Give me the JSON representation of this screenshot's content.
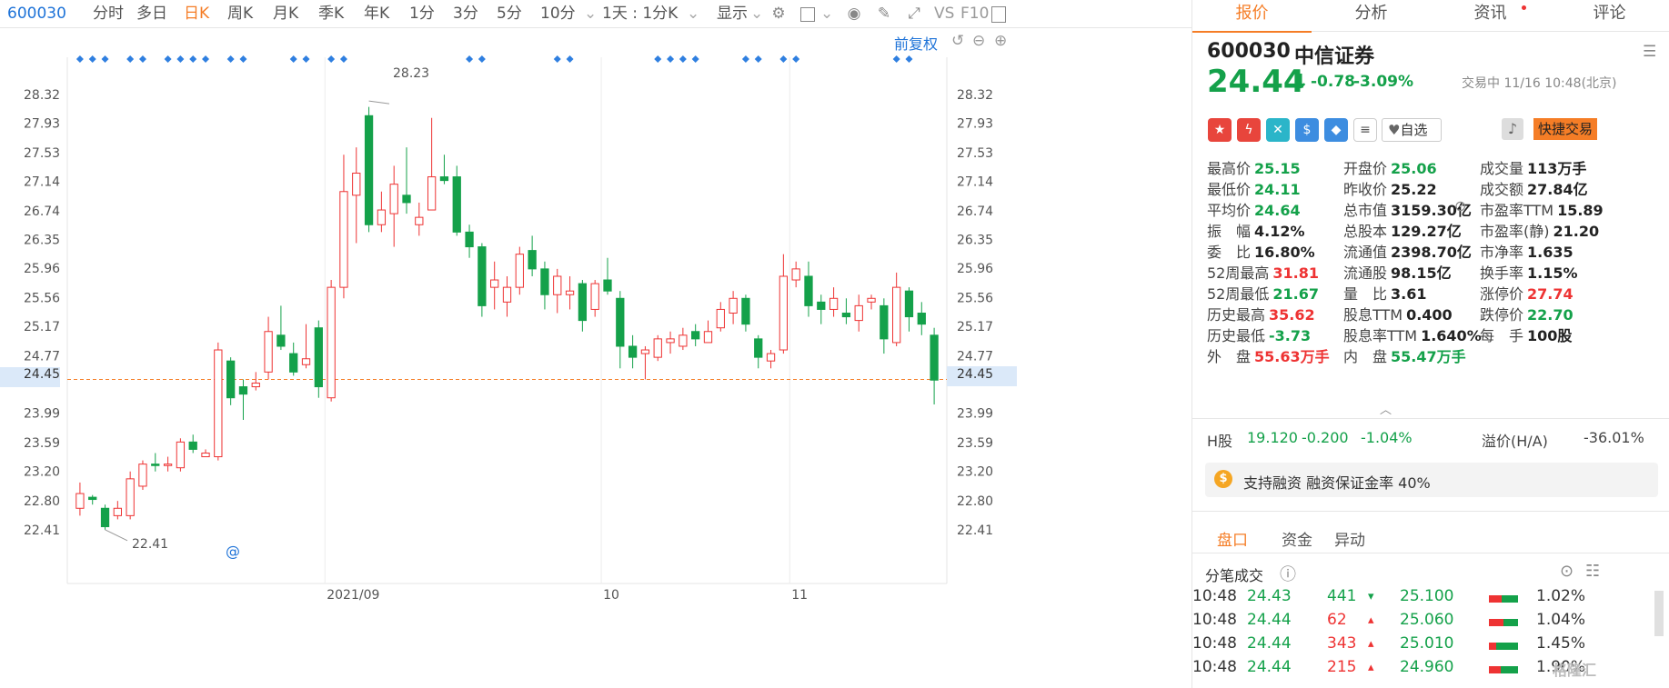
{
  "toolbar": {
    "code": "600030",
    "periods": [
      "分时",
      "多日",
      "日K",
      "周K",
      "月K",
      "季K",
      "年K",
      "1分",
      "3分",
      "5分",
      "10分"
    ],
    "active_period": "日K",
    "interval_select": "1天 : 1分K",
    "display_label": "显示",
    "vs_label": "VS",
    "f10_label": "F10"
  },
  "chart": {
    "restore_label": "前复权",
    "current_price_label": "24.45",
    "max_annotation": "28.23",
    "min_annotation": "22.41",
    "month_labels": [
      "2021/09",
      "10",
      "11"
    ]
  },
  "chart_data": {
    "type": "candlestick",
    "y_ticks": [
      28.32,
      27.93,
      27.53,
      27.14,
      26.74,
      26.35,
      25.96,
      25.56,
      25.17,
      24.77,
      24.45,
      23.99,
      23.59,
      23.2,
      22.8,
      22.41
    ],
    "ylim": [
      22.0,
      28.7
    ],
    "current_price": 24.45,
    "candles": [
      {
        "o": 22.7,
        "c": 22.9,
        "h": 23.05,
        "l": 22.6
      },
      {
        "o": 22.85,
        "c": 22.82,
        "h": 22.88,
        "l": 22.75
      },
      {
        "o": 22.7,
        "c": 22.45,
        "h": 22.75,
        "l": 22.41
      },
      {
        "o": 22.6,
        "c": 22.7,
        "h": 22.8,
        "l": 22.55
      },
      {
        "o": 22.6,
        "c": 23.1,
        "h": 23.2,
        "l": 22.55
      },
      {
        "o": 23.0,
        "c": 23.3,
        "h": 23.35,
        "l": 22.95
      },
      {
        "o": 23.3,
        "c": 23.28,
        "h": 23.45,
        "l": 23.2
      },
      {
        "o": 23.28,
        "c": 23.3,
        "h": 23.4,
        "l": 23.2
      },
      {
        "o": 23.25,
        "c": 23.6,
        "h": 23.65,
        "l": 23.2
      },
      {
        "o": 23.6,
        "c": 23.5,
        "h": 23.7,
        "l": 23.45
      },
      {
        "o": 23.4,
        "c": 23.45,
        "h": 23.5,
        "l": 23.4
      },
      {
        "o": 23.4,
        "c": 24.85,
        "h": 24.95,
        "l": 23.35
      },
      {
        "o": 24.7,
        "c": 24.2,
        "h": 24.75,
        "l": 24.1
      },
      {
        "o": 24.35,
        "c": 24.25,
        "h": 24.45,
        "l": 23.9
      },
      {
        "o": 24.35,
        "c": 24.4,
        "h": 24.55,
        "l": 24.3
      },
      {
        "o": 24.55,
        "c": 25.1,
        "h": 25.3,
        "l": 24.45
      },
      {
        "o": 25.05,
        "c": 24.9,
        "h": 25.45,
        "l": 24.85
      },
      {
        "o": 24.8,
        "c": 24.55,
        "h": 24.95,
        "l": 24.5
      },
      {
        "o": 24.65,
        "c": 24.73,
        "h": 25.2,
        "l": 24.6
      },
      {
        "o": 25.15,
        "c": 24.35,
        "h": 25.25,
        "l": 24.2
      },
      {
        "o": 24.2,
        "c": 25.7,
        "h": 25.8,
        "l": 24.15
      },
      {
        "o": 25.7,
        "c": 27.0,
        "h": 27.5,
        "l": 25.55
      },
      {
        "o": 26.95,
        "c": 27.25,
        "h": 27.6,
        "l": 26.3
      },
      {
        "o": 28.03,
        "c": 26.55,
        "h": 28.15,
        "l": 26.45
      },
      {
        "o": 26.55,
        "c": 26.75,
        "h": 27.0,
        "l": 26.45
      },
      {
        "o": 26.7,
        "c": 27.1,
        "h": 27.35,
        "l": 26.25
      },
      {
        "o": 26.95,
        "c": 26.85,
        "h": 27.6,
        "l": 26.7
      },
      {
        "o": 26.55,
        "c": 26.65,
        "h": 26.85,
        "l": 26.4
      },
      {
        "o": 26.75,
        "c": 27.2,
        "h": 28.0,
        "l": 26.75
      },
      {
        "o": 27.2,
        "c": 27.15,
        "h": 27.5,
        "l": 27.1
      },
      {
        "o": 27.2,
        "c": 26.45,
        "h": 27.35,
        "l": 26.4
      },
      {
        "o": 26.45,
        "c": 26.25,
        "h": 26.55,
        "l": 26.1
      },
      {
        "o": 26.25,
        "c": 25.45,
        "h": 26.3,
        "l": 25.3
      },
      {
        "o": 25.7,
        "c": 25.8,
        "h": 26.05,
        "l": 25.4
      },
      {
        "o": 25.5,
        "c": 25.7,
        "h": 25.85,
        "l": 25.3
      },
      {
        "o": 25.7,
        "c": 26.15,
        "h": 26.25,
        "l": 25.6
      },
      {
        "o": 26.2,
        "c": 25.95,
        "h": 26.4,
        "l": 25.85
      },
      {
        "o": 25.95,
        "c": 25.6,
        "h": 26.05,
        "l": 25.4
      },
      {
        "o": 25.6,
        "c": 25.85,
        "h": 25.95,
        "l": 25.35
      },
      {
        "o": 25.6,
        "c": 25.65,
        "h": 25.85,
        "l": 25.4
      },
      {
        "o": 25.75,
        "c": 25.25,
        "h": 25.8,
        "l": 25.1
      },
      {
        "o": 25.4,
        "c": 25.75,
        "h": 25.8,
        "l": 25.3
      },
      {
        "o": 25.8,
        "c": 25.65,
        "h": 26.1,
        "l": 25.6
      },
      {
        "o": 25.55,
        "c": 24.9,
        "h": 25.65,
        "l": 24.6
      },
      {
        "o": 24.9,
        "c": 24.75,
        "h": 25.05,
        "l": 24.6
      },
      {
        "o": 24.8,
        "c": 24.85,
        "h": 24.9,
        "l": 24.45
      },
      {
        "o": 24.75,
        "c": 25.0,
        "h": 25.05,
        "l": 24.7
      },
      {
        "o": 24.95,
        "c": 25.0,
        "h": 25.1,
        "l": 24.8
      },
      {
        "o": 24.9,
        "c": 25.05,
        "h": 25.15,
        "l": 24.85
      },
      {
        "o": 25.1,
        "c": 25.0,
        "h": 25.2,
        "l": 24.9
      },
      {
        "o": 24.95,
        "c": 25.1,
        "h": 25.25,
        "l": 24.95
      },
      {
        "o": 25.15,
        "c": 25.4,
        "h": 25.5,
        "l": 25.1
      },
      {
        "o": 25.35,
        "c": 25.55,
        "h": 25.65,
        "l": 25.2
      },
      {
        "o": 25.55,
        "c": 25.2,
        "h": 25.6,
        "l": 25.1
      },
      {
        "o": 25.0,
        "c": 24.75,
        "h": 25.05,
        "l": 24.6
      },
      {
        "o": 24.7,
        "c": 24.8,
        "h": 24.85,
        "l": 24.6
      },
      {
        "o": 24.85,
        "c": 25.85,
        "h": 26.15,
        "l": 24.8
      },
      {
        "o": 25.8,
        "c": 25.95,
        "h": 26.05,
        "l": 25.7
      },
      {
        "o": 25.85,
        "c": 25.45,
        "h": 26.05,
        "l": 25.3
      },
      {
        "o": 25.5,
        "c": 25.4,
        "h": 25.6,
        "l": 25.2
      },
      {
        "o": 25.4,
        "c": 25.55,
        "h": 25.7,
        "l": 25.3
      },
      {
        "o": 25.35,
        "c": 25.3,
        "h": 25.55,
        "l": 25.2
      },
      {
        "o": 25.25,
        "c": 25.45,
        "h": 25.6,
        "l": 25.1
      },
      {
        "o": 25.5,
        "c": 25.55,
        "h": 25.6,
        "l": 25.4
      },
      {
        "o": 25.45,
        "c": 25.0,
        "h": 25.55,
        "l": 24.8
      },
      {
        "o": 24.95,
        "c": 25.7,
        "h": 25.9,
        "l": 24.9
      },
      {
        "o": 25.65,
        "c": 25.3,
        "h": 25.7,
        "l": 25.1
      },
      {
        "o": 25.35,
        "c": 25.2,
        "h": 25.5,
        "l": 25.05
      },
      {
        "o": 25.05,
        "c": 24.44,
        "h": 25.15,
        "l": 24.11
      }
    ],
    "month_index": [
      20,
      42,
      57
    ],
    "marker_index": [
      0,
      1,
      2,
      4,
      5,
      7,
      8,
      9,
      10,
      12,
      13,
      17,
      18,
      20,
      21,
      31,
      32,
      38,
      39,
      46,
      47,
      48,
      49,
      53,
      54,
      56,
      57,
      65,
      66
    ]
  },
  "quote": {
    "code": "600030",
    "name": "中信证券",
    "price": "24.44",
    "arrow": "↓",
    "change": "-0.78",
    "change_pct": "-3.09%",
    "status": "交易中 11/16 10:48(北京)",
    "watch_label": "自选",
    "quick_trade_label": "快捷交易"
  },
  "stats": {
    "col1": [
      {
        "label": "最高价",
        "value": "25.15",
        "color": "green"
      },
      {
        "label": "最低价",
        "value": "24.11",
        "color": "green"
      },
      {
        "label": "平均价",
        "value": "24.64",
        "color": "green"
      },
      {
        "label": "振　幅",
        "value": "4.12%",
        "color": "normal"
      },
      {
        "label": "委　比",
        "value": "16.80%",
        "color": "normal"
      },
      {
        "label": "52周最高",
        "value": "31.81",
        "color": "red"
      },
      {
        "label": "52周最低",
        "value": "21.67",
        "color": "green"
      },
      {
        "label": "历史最高",
        "value": "35.62",
        "color": "red"
      },
      {
        "label": "历史最低",
        "value": "-3.73",
        "color": "green"
      },
      {
        "label": "外　盘",
        "value": "55.63万手",
        "color": "red"
      }
    ],
    "col2": [
      {
        "label": "开盘价",
        "value": "25.06",
        "color": "green"
      },
      {
        "label": "昨收价",
        "value": "25.22",
        "color": "normal"
      },
      {
        "label": "总市值",
        "value": "3159.30亿",
        "color": "normal"
      },
      {
        "label": "总股本",
        "value": "129.27亿",
        "color": "normal"
      },
      {
        "label": "流通值",
        "value": "2398.70亿",
        "color": "normal"
      },
      {
        "label": "流通股",
        "value": "98.15亿",
        "color": "normal"
      },
      {
        "label": "量　比",
        "value": "3.61",
        "color": "normal"
      },
      {
        "label": "股息TTM",
        "value": "0.400",
        "color": "normal"
      },
      {
        "label": "股息率TTM",
        "value": "1.640%",
        "color": "normal"
      },
      {
        "label": "内　盘",
        "value": "55.47万手",
        "color": "green"
      }
    ],
    "col3": [
      {
        "label": "成交量",
        "value": "113万手",
        "color": "normal"
      },
      {
        "label": "成交额",
        "value": "27.84亿",
        "color": "normal"
      },
      {
        "label": "市盈率TTM",
        "value": "15.89",
        "color": "normal"
      },
      {
        "label": "市盈率(静)",
        "value": "21.20",
        "color": "normal"
      },
      {
        "label": "市净率",
        "value": "1.635",
        "color": "normal"
      },
      {
        "label": "换手率",
        "value": "1.15%",
        "color": "normal"
      },
      {
        "label": "涨停价",
        "value": "27.74",
        "color": "red"
      },
      {
        "label": "跌停价",
        "value": "22.70",
        "color": "green"
      },
      {
        "label": "每　手",
        "value": "100股",
        "color": "normal"
      }
    ]
  },
  "hshare": {
    "label": "H股",
    "price": "19.120",
    "change": "-0.200",
    "pct": "-1.04%",
    "premium_label": "溢价(H/A)",
    "premium": "-36.01%"
  },
  "margin_note": "支持融资 融资保证金率 40%",
  "subtabs": [
    "盘口",
    "资金",
    "异动"
  ],
  "ticks_title": "分笔成交",
  "ticks": [
    {
      "time": "10:48",
      "price": "24.43",
      "vol": "441",
      "dir": "down",
      "level": "25.100",
      "pct": "1.02%",
      "fill": 0.55
    },
    {
      "time": "10:48",
      "price": "24.44",
      "vol": "62",
      "dir": "up",
      "level": "25.060",
      "pct": "1.04%",
      "fill": 0.5
    },
    {
      "time": "10:48",
      "price": "24.44",
      "vol": "343",
      "dir": "up",
      "level": "25.010",
      "pct": "1.45%",
      "fill": 0.75
    },
    {
      "time": "10:48",
      "price": "24.44",
      "vol": "215",
      "dir": "up",
      "level": "24.960",
      "pct": "1.90%",
      "fill": 0.6
    }
  ],
  "watermark": "格隆汇",
  "colors": {
    "up": "#e33",
    "down": "#14a14a",
    "accent": "#f57d26",
    "blue": "#1e73d8"
  }
}
